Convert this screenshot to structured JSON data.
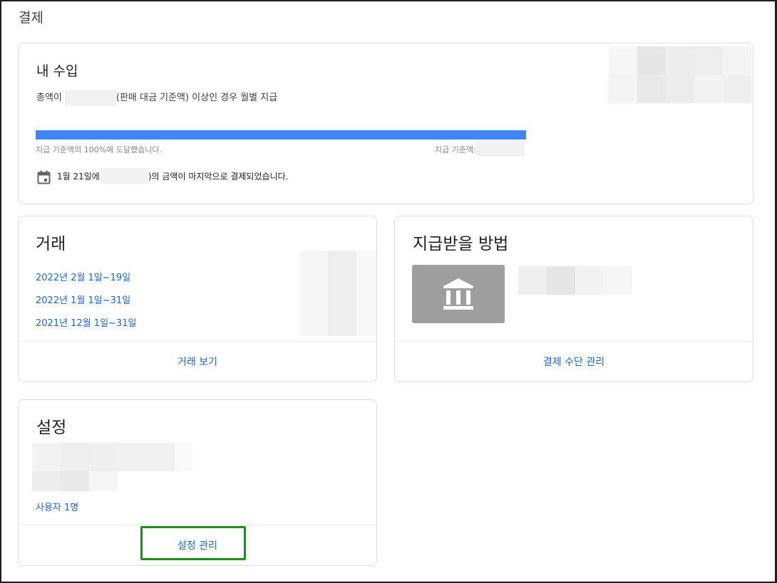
{
  "page": {
    "title": "결제"
  },
  "earnings": {
    "title": "내 수입",
    "threshold_prefix": "총액이",
    "threshold_suffix": "(판매 대금 기준액) 이상인 경우 월별 지급",
    "progress_label": "지급 기준액의 100%에 도달했습니다.",
    "threshold_label": "지급 기준액:",
    "progress_percent": 100,
    "last_payment_prefix": "1월 21일에",
    "last_payment_suffix": ")의 금액이 마지막으로 결제되었습니다."
  },
  "transactions": {
    "title": "거래",
    "items": [
      {
        "label": "2022년 2월 1일~19일"
      },
      {
        "label": "2022년 1월 1일~31일"
      },
      {
        "label": "2021년 12월 1일~31일"
      }
    ],
    "footer_label": "거래 보기"
  },
  "payment_method": {
    "title": "지급받을 방법",
    "footer_label": "결제 수단 관리"
  },
  "settings": {
    "title": "설정",
    "users_label": "사용자 1명",
    "footer_label": "설정 관리"
  },
  "colors": {
    "accent": "#4285f4",
    "link": "#1967d2",
    "highlight": "#1e8e1e"
  }
}
